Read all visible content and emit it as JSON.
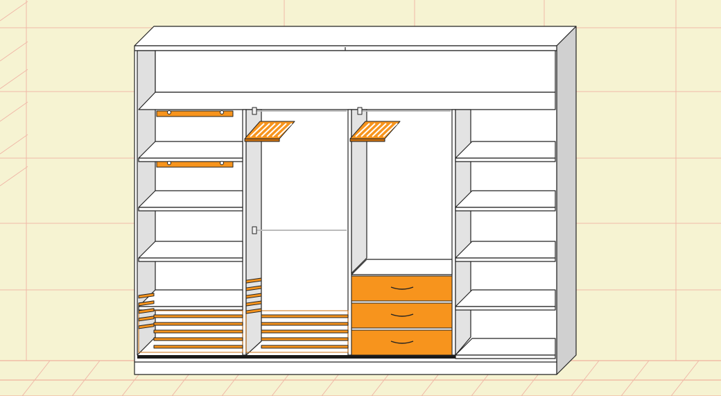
{
  "scene": {
    "subject": "wardrobe-3d-view",
    "colors": {
      "background": "#f6f3d2",
      "grid": "#f0b8a8",
      "grid_strong": "#eea090",
      "cabinet_front": "#ffffff",
      "cabinet_side": "#d8d8d8",
      "inner_side": "#e6e6e6",
      "outline": "#222222",
      "accent": "#f7941d",
      "accent_dark": "#c86f10"
    }
  },
  "wardrobe": {
    "sections": [
      {
        "id": "left-shelving",
        "shelf_count": 5,
        "pull_out_racks": 2,
        "basket": true
      },
      {
        "id": "hanging-long",
        "hanging_rails": 2,
        "pull_out_trouser_rack": true,
        "basket": true
      },
      {
        "id": "hanging-drawers",
        "hanging_rails": 1,
        "pull_out_trouser_rack": true,
        "drawer_count": 3
      },
      {
        "id": "right-shelving",
        "shelf_count": 5
      }
    ]
  }
}
